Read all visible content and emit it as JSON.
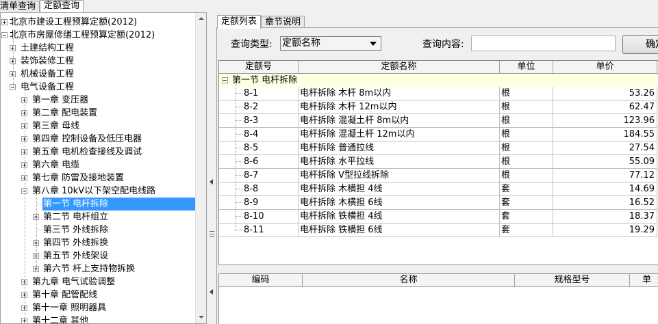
{
  "top_tabs": [
    {
      "label": "清单查询"
    },
    {
      "label": "定额查询"
    }
  ],
  "tree": {
    "items": [
      {
        "label": "北京市建设工程预算定额(2012)",
        "level": 0,
        "expander": "plus",
        "selected": false
      },
      {
        "label": "北京市房屋修缮工程预算定额(2012)",
        "level": 0,
        "expander": "minus",
        "selected": false
      },
      {
        "label": "土建结构工程",
        "level": 1,
        "expander": "plus",
        "selected": false
      },
      {
        "label": "装饰装修工程",
        "level": 1,
        "expander": "plus",
        "selected": false
      },
      {
        "label": "机械设备工程",
        "level": 1,
        "expander": "plus",
        "selected": false
      },
      {
        "label": "电气设备工程",
        "level": 1,
        "expander": "minus",
        "selected": false
      },
      {
        "label": "第一章  变压器",
        "level": 2,
        "expander": "plus",
        "selected": false
      },
      {
        "label": "第二章  配电装置",
        "level": 2,
        "expander": "plus",
        "selected": false
      },
      {
        "label": "第三章  母线",
        "level": 2,
        "expander": "plus",
        "selected": false
      },
      {
        "label": "第四章  控制设备及低压电器",
        "level": 2,
        "expander": "plus",
        "selected": false
      },
      {
        "label": "第五章  电机检查接线及调试",
        "level": 2,
        "expander": "plus",
        "selected": false
      },
      {
        "label": "第六章  电缆",
        "level": 2,
        "expander": "plus",
        "selected": false
      },
      {
        "label": "第七章  防雷及接地装置",
        "level": 2,
        "expander": "plus",
        "selected": false
      },
      {
        "label": "第八章  10kV以下架空配电线路",
        "level": 2,
        "expander": "minus",
        "selected": false
      },
      {
        "label": "第一节  电杆拆除",
        "level": 3,
        "expander": "none",
        "selected": true
      },
      {
        "label": "第二节  电杆组立",
        "level": 3,
        "expander": "plus",
        "selected": false
      },
      {
        "label": "第三节  外线拆除",
        "level": 3,
        "expander": "none",
        "selected": false
      },
      {
        "label": "第四节  外线拆换",
        "level": 3,
        "expander": "plus",
        "selected": false
      },
      {
        "label": "第五节  外线架设",
        "level": 3,
        "expander": "plus",
        "selected": false
      },
      {
        "label": "第六节  杆上支持物拆换",
        "level": 3,
        "expander": "plus",
        "selected": false
      },
      {
        "label": "第九章  电气试验调整",
        "level": 2,
        "expander": "plus",
        "selected": false
      },
      {
        "label": "第十章  配管配线",
        "level": 2,
        "expander": "plus",
        "selected": false
      },
      {
        "label": "第十一章  照明器具",
        "level": 2,
        "expander": "plus",
        "selected": false
      },
      {
        "label": "第十二章  其他",
        "level": 2,
        "expander": "plus",
        "selected": false
      }
    ]
  },
  "right_tabs": [
    {
      "label": "定额列表"
    },
    {
      "label": "章节说明"
    }
  ],
  "search": {
    "type_label": "查询类型:",
    "type_value": "定额名称",
    "content_label": "查询内容:",
    "content_value": "",
    "confirm_label": "确定"
  },
  "main_table": {
    "columns": [
      "定额号",
      "定额名称",
      "单位",
      "单价"
    ],
    "group_label": "第一节  电杆拆除",
    "rows": [
      {
        "code": "8-1",
        "name": "电杆拆除  木杆  8m以内",
        "unit": "根",
        "price": "53.26"
      },
      {
        "code": "8-2",
        "name": "电杆拆除  木杆  12m以内",
        "unit": "根",
        "price": "62.47"
      },
      {
        "code": "8-3",
        "name": "电杆拆除  混凝土杆  8m以内",
        "unit": "根",
        "price": "123.96"
      },
      {
        "code": "8-4",
        "name": "电杆拆除  混凝土杆  12m以内",
        "unit": "根",
        "price": "184.55"
      },
      {
        "code": "8-5",
        "name": "电杆拆除  普通拉线",
        "unit": "根",
        "price": "27.54"
      },
      {
        "code": "8-6",
        "name": "电杆拆除  水平拉线",
        "unit": "根",
        "price": "55.09"
      },
      {
        "code": "8-7",
        "name": "电杆拆除  V型拉线拆除",
        "unit": "根",
        "price": "77.12"
      },
      {
        "code": "8-8",
        "name": "电杆拆除  木横担  4线",
        "unit": "套",
        "price": "14.69"
      },
      {
        "code": "8-9",
        "name": "电杆拆除  木横担  6线",
        "unit": "套",
        "price": "16.52"
      },
      {
        "code": "8-10",
        "name": "电杆拆除  铁横担  4线",
        "unit": "套",
        "price": "18.37"
      },
      {
        "code": "8-11",
        "name": "电杆拆除  铁横担  6线",
        "unit": "套",
        "price": "19.29"
      }
    ]
  },
  "detail_table": {
    "columns": [
      "编码",
      "名称",
      "规格型号",
      "单"
    ]
  },
  "icons": {
    "expand": "plus-box-icon",
    "collapse": "minus-box-icon",
    "splitter": "chevron-left-icon",
    "grip": "grip-lines-icon"
  },
  "colors": {
    "selection": "#3399ff",
    "group_row": "#ffffe1",
    "header": "#f4f4f4"
  }
}
